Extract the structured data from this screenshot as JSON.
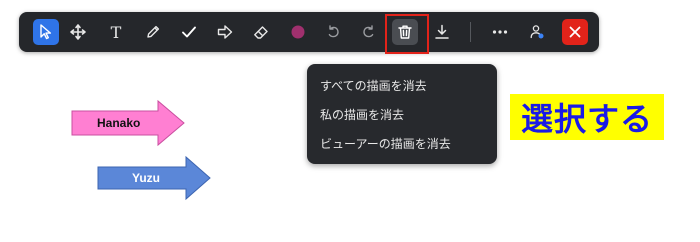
{
  "toolbar": {
    "tools": [
      {
        "name": "select-tool",
        "icon": "cursor-arrow-icon"
      },
      {
        "name": "move-tool",
        "icon": "move-cross-icon"
      },
      {
        "name": "text-tool",
        "icon": "text-t-icon",
        "glyph": "T"
      },
      {
        "name": "pen-tool",
        "icon": "pencil-icon"
      },
      {
        "name": "check-tool",
        "icon": "checkmark-icon"
      },
      {
        "name": "arrow-tool",
        "icon": "arrow-right-outline-icon"
      },
      {
        "name": "eraser-tool",
        "icon": "eraser-icon"
      },
      {
        "name": "color-picker",
        "icon": "color-dot-icon"
      },
      {
        "name": "undo-button",
        "icon": "undo-icon"
      },
      {
        "name": "redo-button",
        "icon": "redo-icon"
      },
      {
        "name": "delete-button",
        "icon": "trash-icon"
      },
      {
        "name": "save-button",
        "icon": "download-icon"
      },
      {
        "name": "more-button",
        "icon": "more-dots-icon"
      },
      {
        "name": "user-button",
        "icon": "person-icon"
      },
      {
        "name": "close-button",
        "icon": "close-x-icon"
      }
    ],
    "colors": {
      "background": "#25272b",
      "selected": "#2f74e8",
      "active_color": "#a0306e",
      "close": "#e2231a"
    }
  },
  "delete_menu": {
    "items": [
      {
        "label": "すべての描画を消去"
      },
      {
        "label": "私の描画を消去"
      },
      {
        "label": "ビューアーの描画を消去"
      }
    ]
  },
  "callout": {
    "text": "選択する"
  },
  "canvas": {
    "arrows": [
      {
        "label": "Hanako",
        "color": "#ff7fd2"
      },
      {
        "label": "Yuzu",
        "color": "#5b87d8"
      }
    ]
  }
}
